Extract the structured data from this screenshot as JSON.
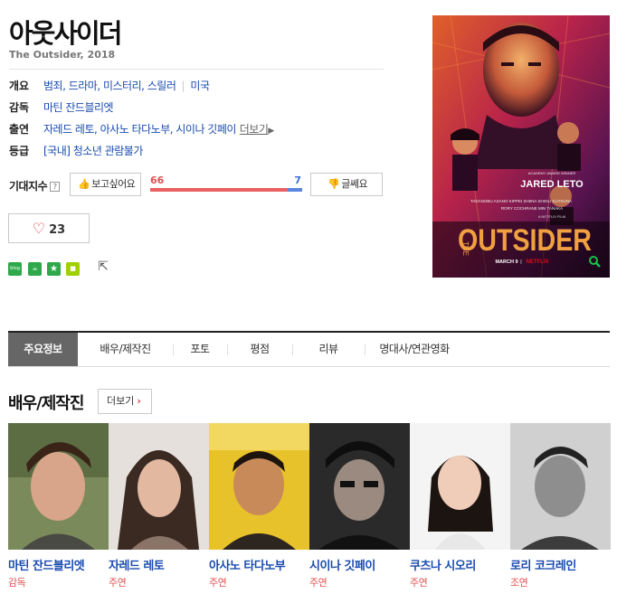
{
  "title": "아웃사이더",
  "subtitle": "The Outsider, 2018",
  "info": {
    "overview_label": "개요",
    "genres": "범죄, 드라마, 미스터리, 스릴러",
    "country": "미국",
    "director_label": "감독",
    "director": "마틴 잔드블리엣",
    "cast_label": "출연",
    "cast": "자레드 레토, 아사노 타다노부, 시이나 깃페이",
    "cast_more": "더보기",
    "rating_label": "등급",
    "rating": "[국내] 청소년 관람불가"
  },
  "expectation": {
    "label": "기대지수",
    "help": "?",
    "want_label": "보고싶어요",
    "not_want_label": "글쎄요",
    "want_count": 66,
    "not_want_count": 7
  },
  "like": {
    "count": "23"
  },
  "share_icons": [
    "blog-icon",
    "cafe-icon",
    "bookmark-star-icon",
    "square-icon",
    "export-share-icon"
  ],
  "share_labels": {
    "blog": "blog"
  },
  "poster": {
    "credit_top": "ACADEMY AWARD WINNER",
    "star": "JARED LETO",
    "cast_line1": "TADANOBU ASANO   KIPPEI SHIINA   SHIOLI KUTSUNA",
    "cast_line2": "RORY COCHRANE   MIN TANAKA",
    "small_title_letters": "THE",
    "big_title": "OUTSIDER",
    "netflix_film": "A NETFLIX FILM",
    "release": "MARCH 9",
    "brand": "NETFLIX",
    "brand_color": "#e50914"
  },
  "tabs": [
    {
      "label": "주요정보",
      "active": true
    },
    {
      "label": "배우/제작진",
      "active": false
    },
    {
      "label": "포토",
      "active": false
    },
    {
      "label": "평점",
      "active": false
    },
    {
      "label": "리뷰",
      "active": false
    },
    {
      "label": "명대사/연관영화",
      "active": false
    }
  ],
  "section": {
    "title": "배우/제작진",
    "more": "더보기"
  },
  "people": [
    {
      "name": "마틴 잔드블리엣",
      "role": "감독"
    },
    {
      "name": "자레드 레토",
      "role": "주연"
    },
    {
      "name": "아사노 타다노부",
      "role": "주연"
    },
    {
      "name": "시이나 깃페이",
      "role": "주연"
    },
    {
      "name": "쿠츠나 시오리",
      "role": "주연"
    },
    {
      "name": "로리 코크레인",
      "role": "조연"
    }
  ],
  "colors": {
    "link_blue": "#1a4bb0",
    "role_red": "#e05050",
    "want_red": "#ea5f5f",
    "notwant_blue": "#5b86dd",
    "tab_active_bg": "#666666"
  }
}
